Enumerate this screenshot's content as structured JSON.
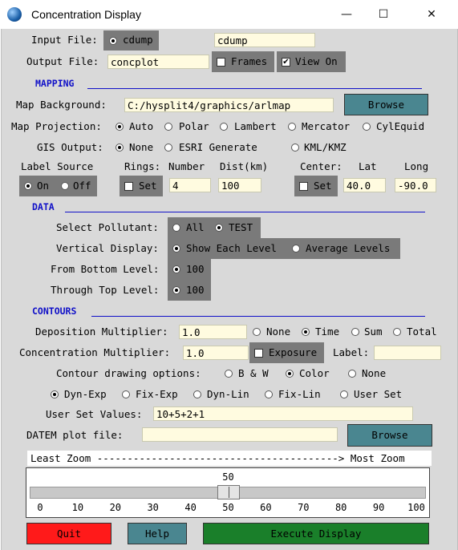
{
  "window": {
    "title": "Concentration Display",
    "minimize": "—",
    "maximize": "☐",
    "close": "✕"
  },
  "input_file": {
    "label": "Input File:",
    "radio_label": "cdump",
    "value": "cdump"
  },
  "output_file": {
    "label": "Output File:",
    "value": "concplot",
    "frames_label": "Frames",
    "frames_checked": false,
    "viewon_label": "View On",
    "viewon_checked": true
  },
  "mapping": {
    "header": "MAPPING",
    "map_background_label": "Map Background:",
    "map_background_value": "C:/hysplit4/graphics/arlmap",
    "browse_label": "Browse",
    "projection_label": "Map Projection:",
    "projections": [
      "Auto",
      "Polar",
      "Lambert",
      "Mercator",
      "CylEquid"
    ],
    "projection_selected": "Auto",
    "gis_label": "GIS Output:",
    "gis_options": [
      "None",
      "ESRI Generate",
      "KML/KMZ"
    ],
    "gis_selected": "None",
    "label_source_title": "Label Source",
    "label_source_on": "On",
    "label_source_off": "Off",
    "rings_title": "Rings:",
    "rings_set": "Set",
    "number_title": "Number",
    "number_value": "4",
    "dist_title": "Dist(km)",
    "dist_value": "100",
    "center_title": "Center:",
    "center_set": "Set",
    "lat_title": "Lat",
    "lat_value": "40.0",
    "long_title": "Long",
    "long_value": "-90.0"
  },
  "data_section": {
    "header": "DATA",
    "pollutant_label": "Select Pollutant:",
    "pollutant_all": "All",
    "pollutant_test": "TEST",
    "vertical_label": "Vertical Display:",
    "vertical_each": "Show Each Level",
    "vertical_avg": "Average Levels",
    "from_bottom_label": "From Bottom Level:",
    "from_bottom_value": "100",
    "through_top_label": "Through Top Level:",
    "through_top_value": "100"
  },
  "contours": {
    "header": "CONTOURS",
    "deposition_label": "Deposition Multiplier:",
    "deposition_value": "1.0",
    "deposition_options": [
      "None",
      "Time",
      "Sum",
      "Total"
    ],
    "deposition_selected": "Time",
    "concentration_label": "Concentration Multiplier:",
    "concentration_value": "1.0",
    "exposure_label": "Exposure",
    "label_label": "Label:",
    "label_value": "",
    "drawing_label": "Contour drawing options:",
    "drawing_options": [
      "B & W",
      "Color",
      "None"
    ],
    "drawing_selected": "Color",
    "level_options": [
      "Dyn-Exp",
      "Fix-Exp",
      "Dyn-Lin",
      "Fix-Lin",
      "User Set"
    ],
    "level_selected": "Dyn-Exp",
    "user_set_label": "User Set Values:",
    "user_set_value": "10+5+2+1",
    "datem_label": "DATEM plot file:",
    "datem_value": "",
    "datem_browse": "Browse"
  },
  "zoom": {
    "banner": "Least Zoom ----------------------------------------> Most Zoom",
    "value_text": "50",
    "value": 50,
    "ticks": [
      "0",
      "10",
      "20",
      "30",
      "40",
      "50",
      "60",
      "70",
      "80",
      "90",
      "100"
    ]
  },
  "buttons": {
    "quit": "Quit",
    "help": "Help",
    "execute": "Execute Display"
  },
  "colors": {
    "quit": "#ff1a1a",
    "help": "#4a8690",
    "execute": "#1a7f2a",
    "section": "#1010c8",
    "field": "#fffbe0"
  }
}
